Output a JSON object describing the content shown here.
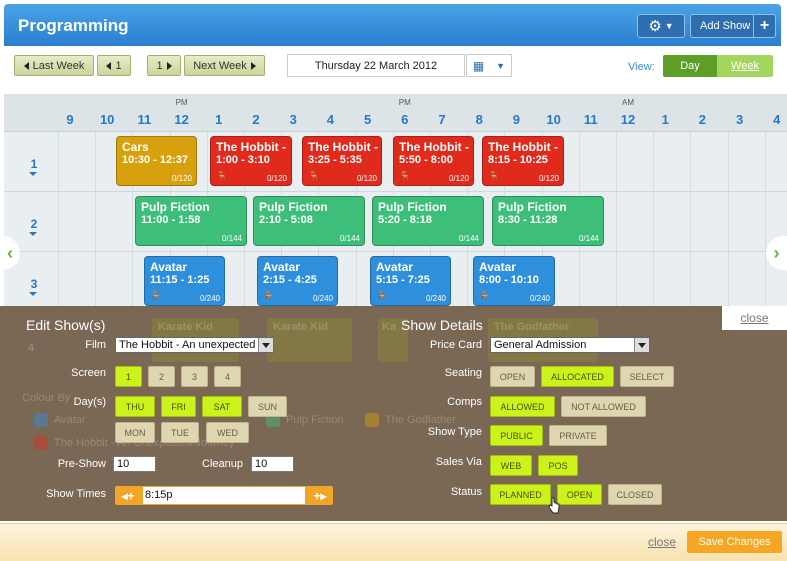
{
  "header": {
    "title": "Programming",
    "add_show_label": "Add Show",
    "gear_icon": "gear-icon"
  },
  "toolbar": {
    "last_week": "Last Week",
    "prev_page": "1",
    "next_page": "1",
    "next_week": "Next Week",
    "date": "Thursday 22 March 2012",
    "view_label": "View:",
    "view_day": "Day",
    "view_week": "Week"
  },
  "timeline": {
    "hours": [
      "9",
      "10",
      "11",
      "12",
      "1",
      "2",
      "3",
      "4",
      "5",
      "6",
      "7",
      "8",
      "9",
      "10",
      "11",
      "12",
      "1",
      "2",
      "3",
      "4"
    ],
    "pm_label": "PM",
    "am_label": "AM"
  },
  "screens": [
    {
      "number": "1",
      "shows": [
        {
          "title": "Cars",
          "time": "10:30 - 12:37",
          "capacity": "0/120",
          "color": "#d7a10e",
          "icon": false
        },
        {
          "title": "The Hobbit -",
          "time": "1:00 - 3:10",
          "capacity": "0/120",
          "color": "#e02a1c",
          "icon": true
        },
        {
          "title": "The Hobbit -",
          "time": "3:25 - 5:35",
          "capacity": "0/120",
          "color": "#e02a1c",
          "icon": true
        },
        {
          "title": "The Hobbit -",
          "time": "5:50 - 8:00",
          "capacity": "0/120",
          "color": "#e02a1c",
          "icon": true
        },
        {
          "title": "The Hobbit -",
          "time": "8:15 - 10:25",
          "capacity": "0/120",
          "color": "#e02a1c",
          "icon": true
        }
      ]
    },
    {
      "number": "2",
      "shows": [
        {
          "title": "Pulp Fiction",
          "time": "11:00 - 1:58",
          "capacity": "0/144",
          "color": "#3dbf7a",
          "icon": false
        },
        {
          "title": "Pulp Fiction",
          "time": "2:10 - 5:08",
          "capacity": "0/144",
          "color": "#3dbf7a",
          "icon": false
        },
        {
          "title": "Pulp Fiction",
          "time": "5:20 - 8:18",
          "capacity": "0/144",
          "color": "#3dbf7a",
          "icon": false
        },
        {
          "title": "Pulp Fiction",
          "time": "8:30 - 11:28",
          "capacity": "0/144",
          "color": "#3dbf7a",
          "icon": false
        }
      ]
    },
    {
      "number": "3",
      "shows": [
        {
          "title": "Avatar",
          "time": "11:15 - 1:25",
          "capacity": "0/240",
          "color": "#2e8fdc",
          "icon": true
        },
        {
          "title": "Avatar",
          "time": "2:15 - 4:25",
          "capacity": "0/240",
          "color": "#2e8fdc",
          "icon": true
        },
        {
          "title": "Avatar",
          "time": "5:15 - 7:25",
          "capacity": "0/240",
          "color": "#2e8fdc",
          "icon": true
        },
        {
          "title": "Avatar",
          "time": "8:00 - 10:10",
          "capacity": "0/240",
          "color": "#2e8fdc",
          "icon": true
        }
      ]
    }
  ],
  "background_ghost": {
    "screen4": "4",
    "shows": [
      "Karate Kid",
      "Karate Kid",
      "Ka",
      "The Godfather"
    ],
    "colour_by": "Colour By",
    "legend": [
      "Avatar",
      "Pulp Fiction",
      "The Godfather",
      "The Hobbit - An Unexpected Journey"
    ]
  },
  "edit_panel": {
    "title": "Edit Show(s)",
    "film_label": "Film",
    "film_value": "The Hobbit - An unexpected J",
    "screen_label": "Screen",
    "screens": [
      "1",
      "2",
      "3",
      "4"
    ],
    "days_label": "Day(s)",
    "days": [
      "THU",
      "FRI",
      "SAT",
      "SUN",
      "MON",
      "TUE",
      "WED"
    ],
    "preshow_label": "Pre-Show",
    "preshow_value": "10",
    "cleanup_label": "Cleanup",
    "cleanup_value": "10",
    "showtimes_label": "Show Times",
    "showtime_value": "8:15p",
    "close": "close"
  },
  "details_panel": {
    "title": "Show Details",
    "price_card_label": "Price Card",
    "price_card_value": "General Admission",
    "seating_label": "Seating",
    "seating": [
      "OPEN",
      "ALLOCATED",
      "SELECT"
    ],
    "comps_label": "Comps",
    "comps": [
      "ALLOWED",
      "NOT ALLOWED"
    ],
    "show_type_label": "Show Type",
    "show_type": [
      "PUBLIC",
      "PRIVATE"
    ],
    "sales_via_label": "Sales Via",
    "sales_via": [
      "WEB",
      "POS"
    ],
    "status_label": "Status",
    "status": [
      "PLANNED",
      "OPEN",
      "CLOSED"
    ]
  },
  "footer": {
    "close": "close",
    "save": "Save Changes"
  }
}
